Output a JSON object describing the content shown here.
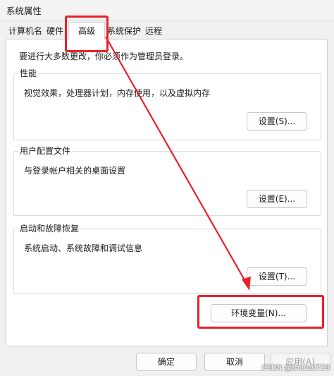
{
  "window": {
    "title": "系统属性"
  },
  "tabs": [
    {
      "label": "计算机名"
    },
    {
      "label": "硬件"
    },
    {
      "label": "高级"
    },
    {
      "label": "系统保护"
    },
    {
      "label": "远程"
    }
  ],
  "active_tab": "高级",
  "admin_note": "要进行大多数更改，你必须作为管理员登录。",
  "groups": {
    "performance": {
      "title": "性能",
      "description": "视觉效果，处理器计划，内存使用，以及虚拟内存",
      "button": "设置(S)..."
    },
    "user_profiles": {
      "title": "用户配置文件",
      "description": "与登录帐户相关的桌面设置",
      "button": "设置(E)..."
    },
    "startup_recovery": {
      "title": "启动和故障恢复",
      "description": "系统启动、系统故障和调试信息",
      "button": "设置(T)..."
    }
  },
  "env_button": "环境变量(N)...",
  "footer": {
    "ok": "确定",
    "cancel": "取消",
    "apply": "应用(A)"
  },
  "watermark": "CSDN @zhenz0729",
  "colors": {
    "annotation_red": "#e8212c"
  }
}
